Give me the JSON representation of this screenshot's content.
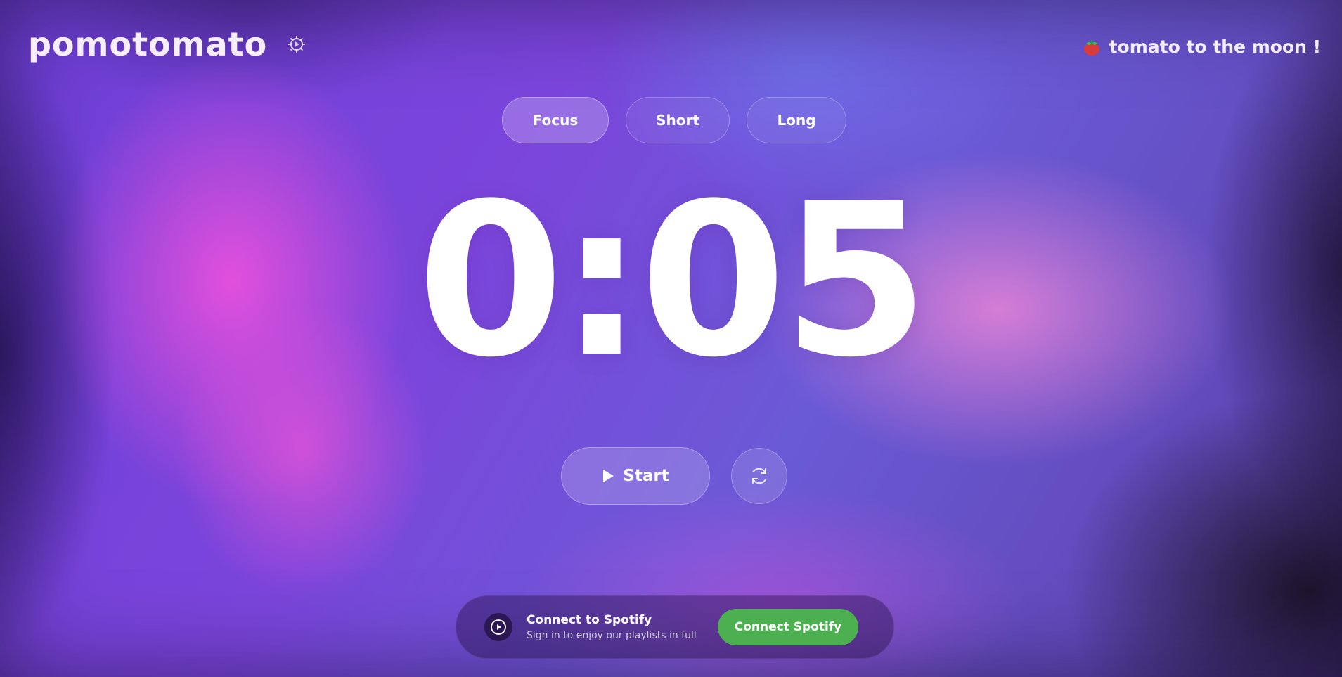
{
  "app": {
    "logo_text": "pomotomato",
    "settings_icon": "gear-icon",
    "tagline": "tomato to the moon !",
    "tagline_icon": "tomato-icon"
  },
  "modes": {
    "items": [
      {
        "label": "Focus",
        "active": true
      },
      {
        "label": "Short",
        "active": false
      },
      {
        "label": "Long",
        "active": false
      }
    ]
  },
  "timer": {
    "display": "0:05"
  },
  "controls": {
    "start_label": "Start",
    "start_icon": "play-icon",
    "reset_icon": "refresh-icon"
  },
  "spotify": {
    "icon": "play-circle-icon",
    "title": "Connect to Spotify",
    "subtitle": "Sign in to enjoy our playlists in full",
    "button_label": "Connect Spotify"
  },
  "colors": {
    "spotify_green": "#4caf50",
    "text": "#ffffff",
    "pink_glow": "#e850dc",
    "purple_base": "#7b45dc"
  }
}
